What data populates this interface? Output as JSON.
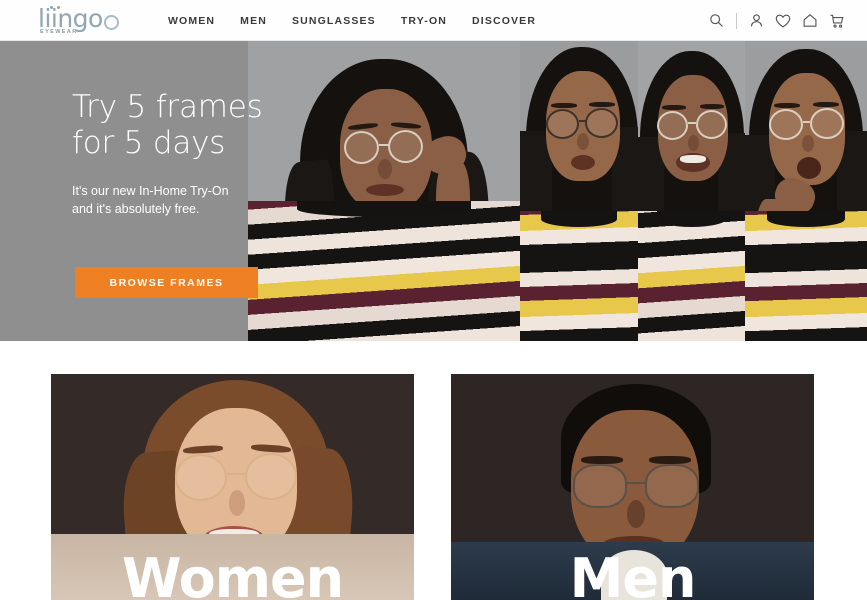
{
  "header": {
    "logo": {
      "word": "liingo",
      "tagline": "EYEWEAR",
      "color": "#90a7b3"
    },
    "nav": [
      {
        "label": "WOMEN"
      },
      {
        "label": "MEN"
      },
      {
        "label": "SUNGLASSES"
      },
      {
        "label": "TRY-ON"
      },
      {
        "label": "DISCOVER"
      }
    ],
    "icons": [
      {
        "name": "search-icon"
      },
      {
        "name": "account-icon"
      },
      {
        "name": "wishlist-heart-icon"
      },
      {
        "name": "home-icon"
      },
      {
        "name": "shopping-cart-icon"
      }
    ]
  },
  "hero": {
    "heading": "Try 5 frames\nfor 5 days",
    "subtext": "It's our new In-Home Try-On\nand it's absolutely free.",
    "cta_label": "BROWSE FRAMES",
    "cta_color": "#ef7f23",
    "background_color": "#8f8f8f"
  },
  "categories": [
    {
      "label": "Women"
    },
    {
      "label": "Men"
    }
  ]
}
